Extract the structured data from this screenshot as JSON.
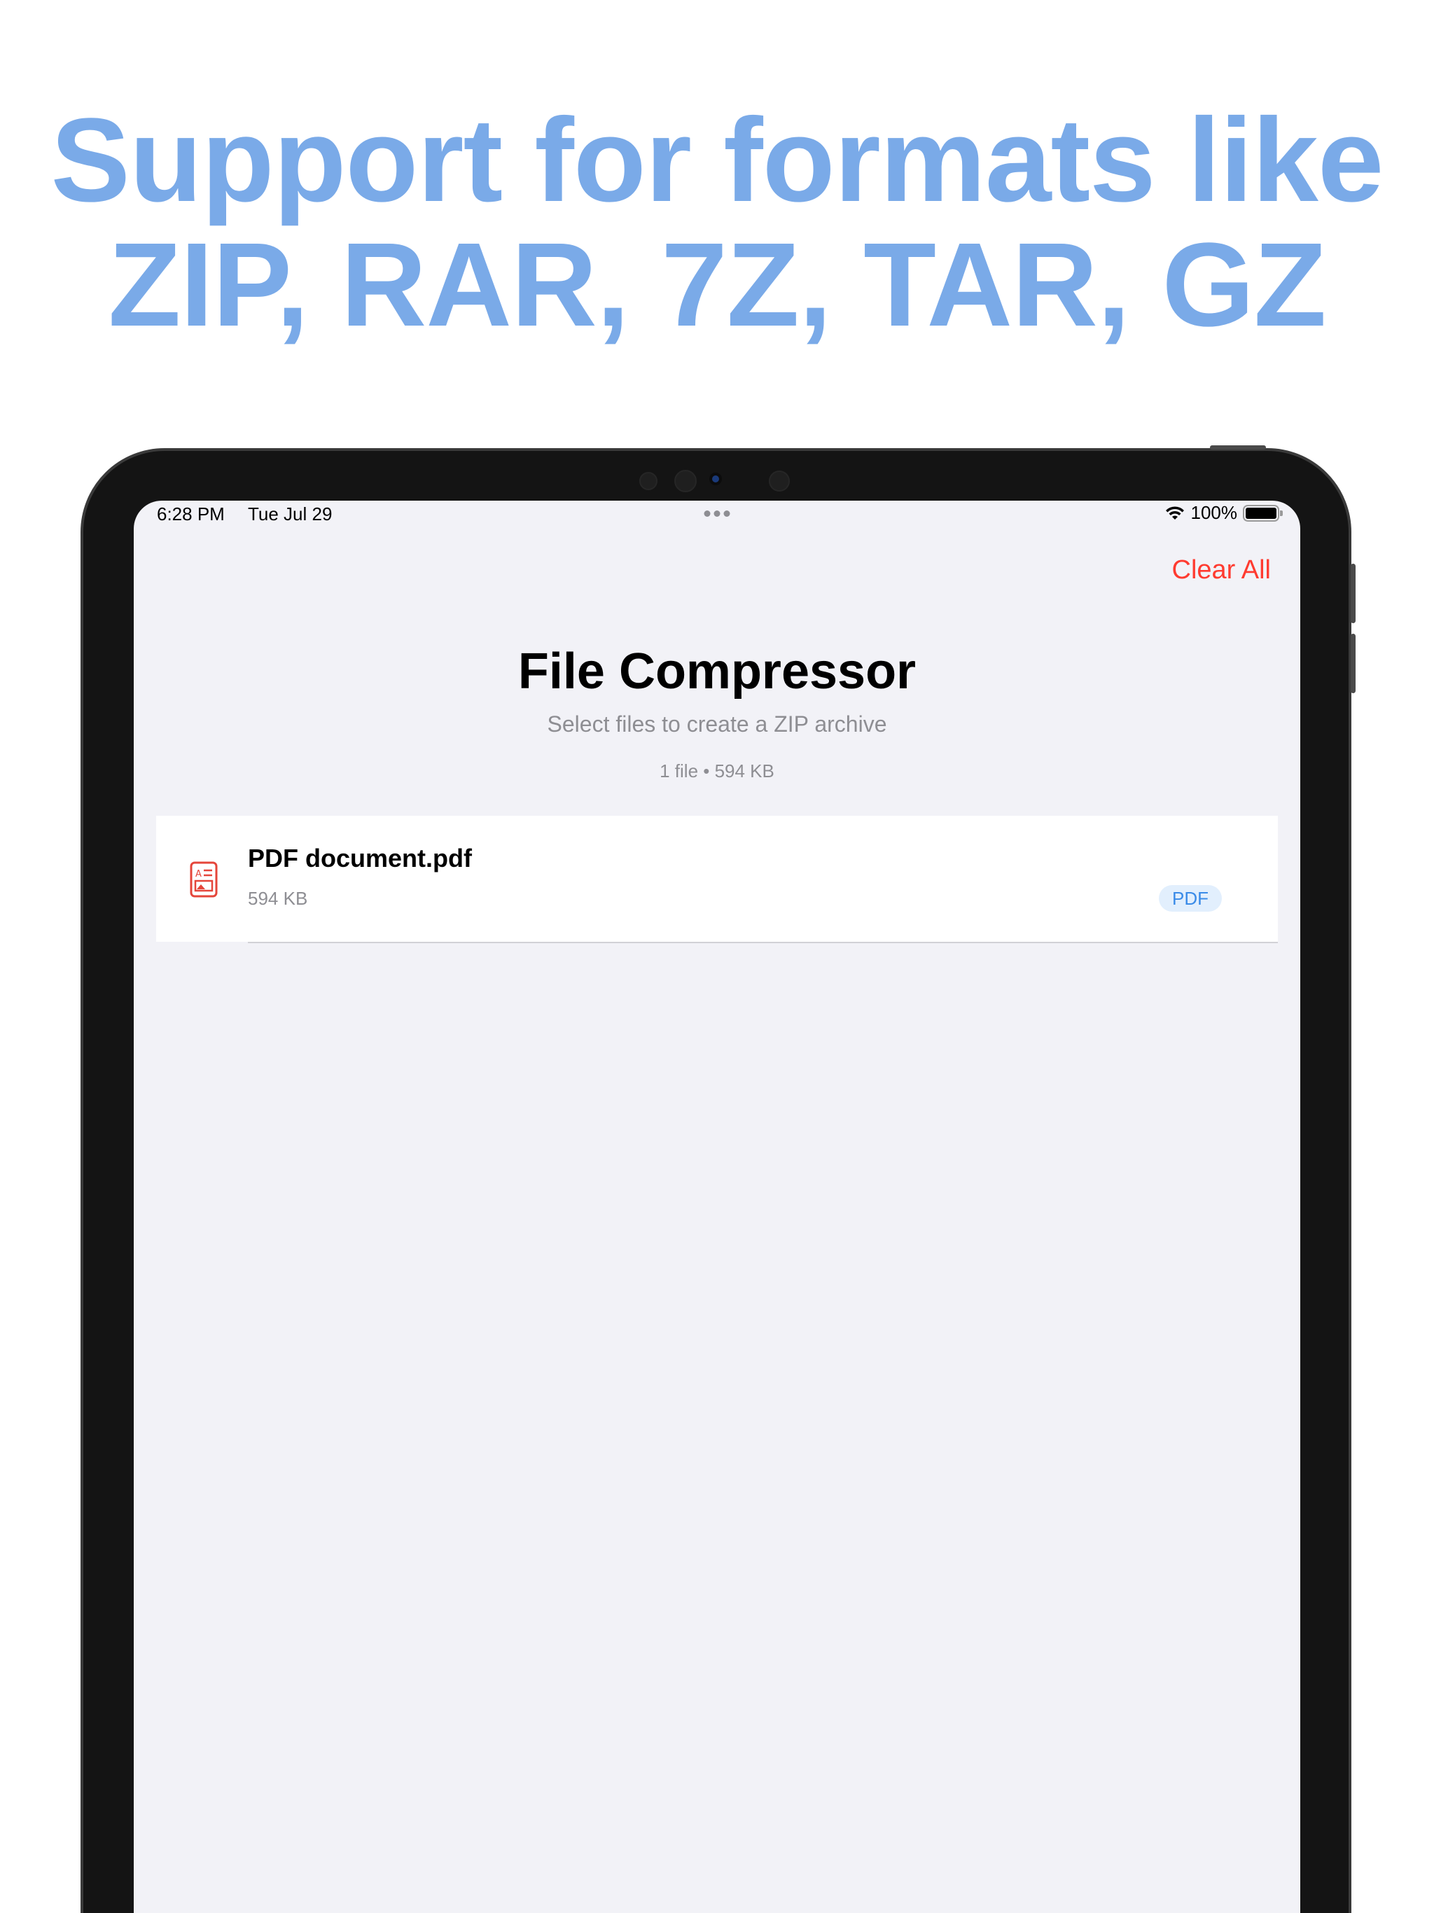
{
  "headline": {
    "line1": "Support for formats like",
    "line2": "ZIP, RAR, 7Z, TAR, GZ"
  },
  "status_bar": {
    "time": "6:28 PM",
    "date": "Tue Jul 29",
    "battery": "100%",
    "battery_level": 1.0
  },
  "nav": {
    "clear_all": "Clear All"
  },
  "header": {
    "title": "File Compressor",
    "subtitle": "Select files to create a ZIP archive",
    "summary": "1 file • 594 KB"
  },
  "files": [
    {
      "name": "PDF document.pdf",
      "size": "594 KB",
      "type": "PDF",
      "icon": "pdf-document-icon"
    }
  ],
  "colors": {
    "headline": "#7aaae8",
    "destructive": "#ff3b30",
    "badge_text": "#3a8be8",
    "badge_bg": "#e2effd",
    "file_icon": "#e5453a"
  }
}
